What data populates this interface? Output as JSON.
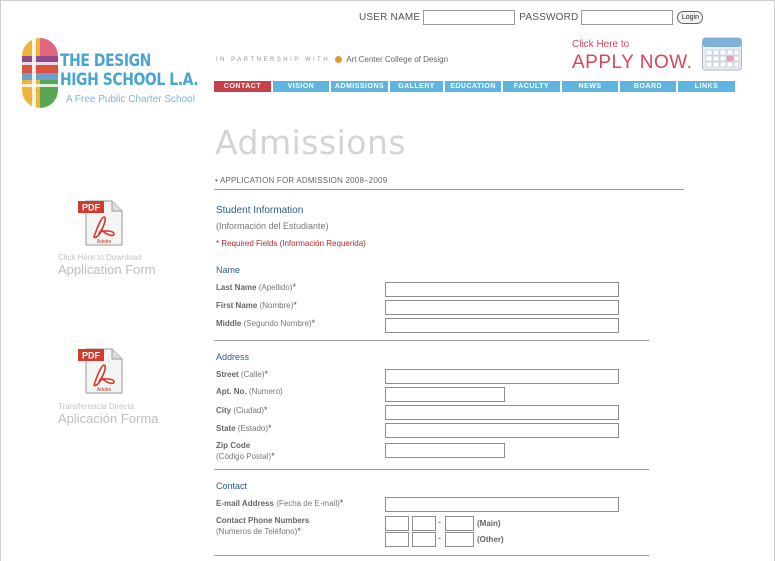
{
  "login": {
    "username_label": "USER NAME",
    "password_label": "PASSWORD",
    "button_label": "Login"
  },
  "logo": {
    "title_line1": "THE DESIGN",
    "title_line2": "HIGH SCHOOL L.A.",
    "tagline": "A Free Public Charter School"
  },
  "partner": {
    "label": "IN PARTNERSHIP WITH",
    "name": "Art Center College of Design"
  },
  "apply": {
    "small": "Click Here to",
    "big": "APPLY NOW."
  },
  "nav": [
    "CONTACT",
    "VISION",
    "ADMISSIONS",
    "GALLERY",
    "EDUCATION",
    "FACULTY",
    "NEWS",
    "BOARD",
    "LINKS"
  ],
  "page": {
    "title": "Admissions",
    "subtitle": "• APPLICATION FOR ADMISSION 2008–2009"
  },
  "downloads": [
    {
      "icon": "PDF",
      "brand": "Adobe",
      "caption": "Click Here to Download",
      "title": "Application Form"
    },
    {
      "icon": "PDF",
      "brand": "Adobe",
      "caption": "Transferencia Directa",
      "title": "Aplicación Forma"
    }
  ],
  "form": {
    "student_title": "Student Information",
    "student_sub": "(Información del Estudiante)",
    "required_note": "*  Required Fields (Información Requerida)",
    "name_section": "Name",
    "last_name": {
      "label": "Last Name",
      "sub": "(Apellido)",
      "star": "*"
    },
    "first_name": {
      "label": "First Name",
      "sub": "(Nombre)",
      "star": "*"
    },
    "middle": {
      "label": "Middle",
      "sub": "(Segundo Nombre)",
      "star": "*"
    },
    "address_section": "Address",
    "street": {
      "label": "Street",
      "sub": "(Calle)",
      "star": "*"
    },
    "apt": {
      "label": "Apt. No.",
      "sub": "(Numero)"
    },
    "city": {
      "label": "City",
      "sub": "(Ciudad)",
      "star": "*"
    },
    "state": {
      "label": "State",
      "sub": "(Estado)",
      "star": "*"
    },
    "zip": {
      "label": "Zip Code",
      "sub": "(Código Postal)",
      "star": "*"
    },
    "contact_section": "Contact",
    "email": {
      "label": "E-mail Address",
      "sub": "(Fecha de E-mail)",
      "star": "*"
    },
    "phone": {
      "label": "Contact Phone Numbers",
      "sub": "(Numeros de Teléfono)",
      "star": "*"
    },
    "phone_main": "(Main)",
    "phone_other": "(Other)",
    "dash": "-"
  }
}
